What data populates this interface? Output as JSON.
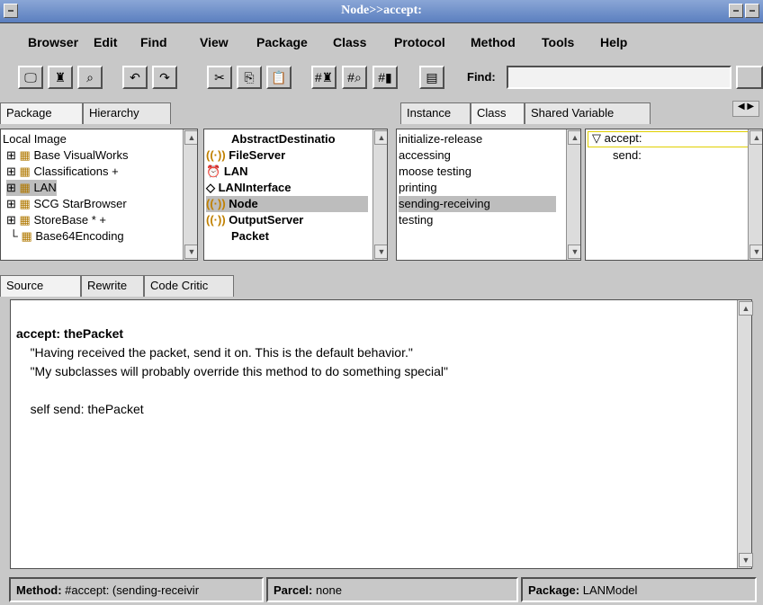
{
  "window": {
    "title": "Node>>accept:"
  },
  "menus": [
    "Browser",
    "Edit",
    "Find",
    "View",
    "Package",
    "Class",
    "Protocol",
    "Method",
    "Tools",
    "Help"
  ],
  "toolbar": {
    "find_label": "Find:",
    "find_value": ""
  },
  "left_tabs": [
    "Package",
    "Hierarchy"
  ],
  "packages": {
    "header": "Local Image",
    "items": [
      "Base VisualWorks",
      "Classifications +",
      "LAN",
      "SCG StarBrowser",
      "StoreBase * +",
      "Base64Encoding"
    ],
    "selected": "LAN"
  },
  "classes": {
    "items": [
      "AbstractDestinatio",
      "FileServer",
      "LAN",
      "LANInterface",
      "Node",
      "OutputServer",
      "Packet"
    ],
    "selected": "Node"
  },
  "right_tabs": [
    "Instance",
    "Class",
    "Shared Variable"
  ],
  "protocols": {
    "items": [
      "initialize-release",
      "accessing",
      "moose testing",
      "printing",
      "sending-receiving",
      "testing"
    ],
    "selected": "sending-receiving"
  },
  "methods": {
    "items": [
      "accept:",
      "send:"
    ],
    "selected": "accept:"
  },
  "source_tabs": [
    "Source",
    "Rewrite",
    "Code Critic"
  ],
  "source": {
    "line1": "accept: thePacket",
    "line2": "\"Having received the packet, send it on. This is the default behavior.\"",
    "line3": "\"My subclasses will probably override this method to do something special\"",
    "line4": "",
    "line5": "self send: thePacket"
  },
  "status": {
    "method_label": "Method:",
    "method_value": "#accept: (sending-receivir",
    "parcel_label": "Parcel:",
    "parcel_value": "none",
    "package_label": "Package:",
    "package_value": "LANModel"
  }
}
